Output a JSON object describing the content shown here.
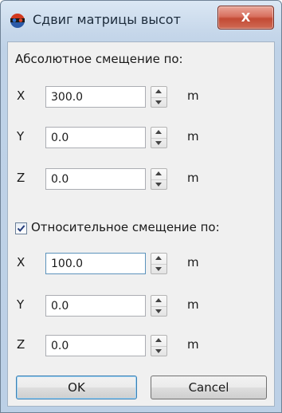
{
  "window": {
    "title": "Сдвиг матрицы высот",
    "icon": "app-logo-icon",
    "close_label": "X"
  },
  "absolute": {
    "label": "Абсолютное смещение по:",
    "rows": [
      {
        "axis": "X",
        "value": "300.0",
        "unit": "m"
      },
      {
        "axis": "Y",
        "value": "0.0",
        "unit": "m"
      },
      {
        "axis": "Z",
        "value": "0.0",
        "unit": "m"
      }
    ]
  },
  "relative": {
    "label": "Относительное смещение по:",
    "checked": true,
    "rows": [
      {
        "axis": "X",
        "value": "100.0",
        "unit": "m"
      },
      {
        "axis": "Y",
        "value": "0.0",
        "unit": "m"
      },
      {
        "axis": "Z",
        "value": "0.0",
        "unit": "m"
      }
    ]
  },
  "buttons": {
    "ok": "OK",
    "cancel": "Cancel"
  },
  "colors": {
    "close_button": "#c94c38",
    "title_bar": "#c6d7ea",
    "focus_border": "#5c93bc"
  }
}
